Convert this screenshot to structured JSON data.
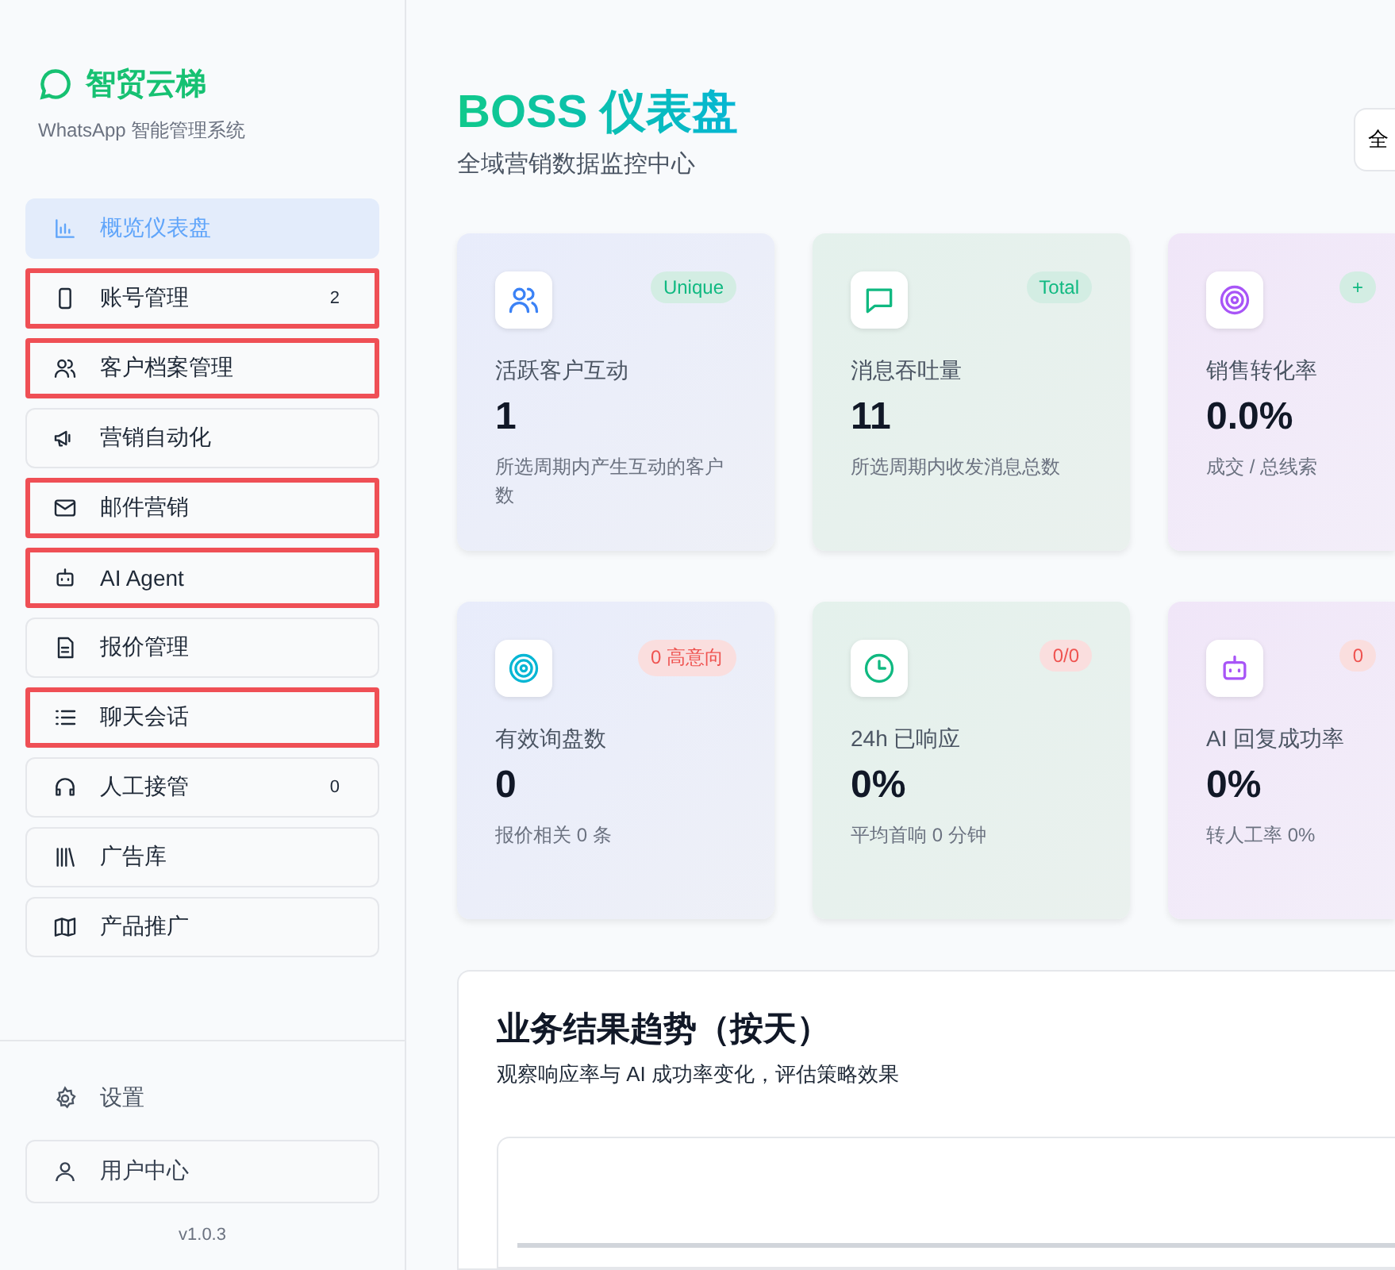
{
  "brand": {
    "name": "智贸云梯",
    "subtitle": "WhatsApp 智能管理系统"
  },
  "nav": [
    {
      "label": "概览仪表盘",
      "selected": true,
      "highlighted": false
    },
    {
      "label": "账号管理",
      "count": "2",
      "selected": false,
      "highlighted": true
    },
    {
      "label": "客户档案管理",
      "selected": false,
      "highlighted": true
    },
    {
      "label": "营销自动化",
      "selected": false,
      "highlighted": false
    },
    {
      "label": "邮件营销",
      "selected": false,
      "highlighted": true
    },
    {
      "label": "AI Agent",
      "selected": false,
      "highlighted": true
    },
    {
      "label": "报价管理",
      "selected": false,
      "highlighted": false
    },
    {
      "label": "聊天会话",
      "selected": false,
      "highlighted": true
    },
    {
      "label": "人工接管",
      "count": "0",
      "selected": false,
      "highlighted": false
    },
    {
      "label": "广告库",
      "selected": false,
      "highlighted": false
    },
    {
      "label": "产品推广",
      "selected": false,
      "highlighted": false
    }
  ],
  "footer": {
    "settings": "设置",
    "user_center": "用户中心",
    "version": "v1.0.3"
  },
  "header": {
    "title": "BOSS 仪表盘",
    "subtitle": "全域营销数据监控中心",
    "range_button": "全"
  },
  "stats": [
    {
      "label": "活跃客户互动",
      "value": "1",
      "note": "所选周期内产生互动的客户数",
      "badge": "Unique",
      "kind": "positive"
    },
    {
      "label": "消息吞吐量",
      "value": "11",
      "note": "所选周期内收发消息总数",
      "badge": "Total",
      "kind": "positive"
    },
    {
      "label": "销售转化率",
      "value": "0.0%",
      "note": "成交 / 总线索",
      "badge": "+",
      "kind": "positive"
    },
    {
      "label": "有效询盘数",
      "value": "0",
      "note": "报价相关 0 条",
      "badge": "0 高意向",
      "kind": "negative"
    },
    {
      "label": "24h 已响应",
      "value": "0%",
      "note": "平均首响 0 分钟",
      "badge": "0/0",
      "kind": "negative"
    },
    {
      "label": "AI 回复成功率",
      "value": "0%",
      "note": "转人工率 0%",
      "badge": "0",
      "kind": "negative"
    }
  ],
  "trend": {
    "title": "业务结果趋势（按天）",
    "subtitle": "观察响应率与 AI 成功率变化，评估策略效果"
  }
}
